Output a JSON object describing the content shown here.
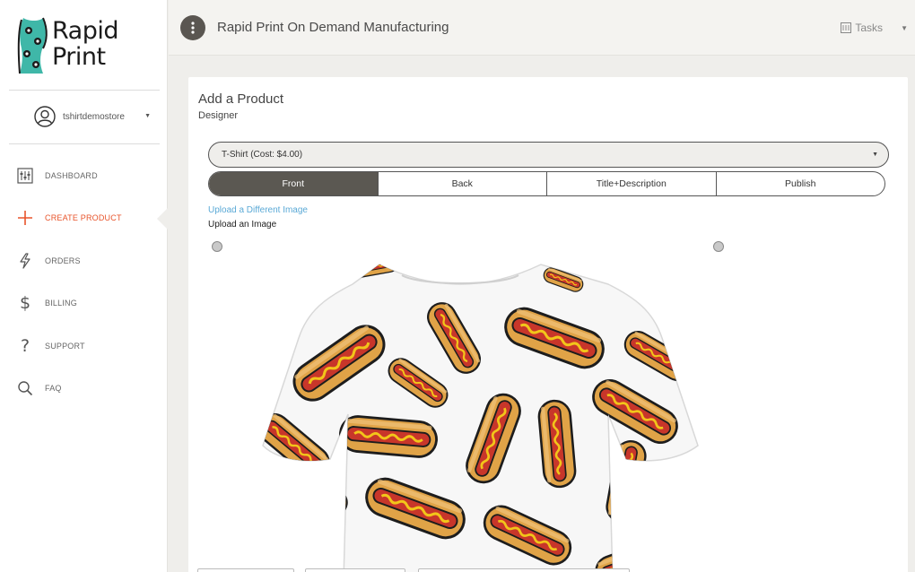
{
  "brand": {
    "line1": "Rapid",
    "line2": "Print"
  },
  "user": {
    "name": "tshirtdemostore"
  },
  "nav": {
    "items": [
      {
        "label": "DASHBOARD",
        "icon": "dashboard-icon"
      },
      {
        "label": "CREATE PRODUCT",
        "icon": "plus-icon"
      },
      {
        "label": "ORDERS",
        "icon": "lightning-icon"
      },
      {
        "label": "BILLING",
        "icon": "dollar-icon"
      },
      {
        "label": "SUPPORT",
        "icon": "question-icon"
      },
      {
        "label": "FAQ",
        "icon": "search-icon"
      }
    ],
    "active_index": 1
  },
  "header": {
    "title": "Rapid Print On Demand Manufacturing",
    "tasks_label": "Tasks"
  },
  "card": {
    "title": "Add a Product",
    "subtitle": "Designer",
    "product_select": {
      "value": "T-Shirt (Cost: $4.00)"
    },
    "tabs": [
      {
        "label": "Front",
        "active": true
      },
      {
        "label": "Back",
        "active": false
      },
      {
        "label": "Title+Description",
        "active": false
      },
      {
        "label": "Publish",
        "active": false
      }
    ],
    "upload_link": "Upload a Different Image",
    "upload_label": "Upload an Image"
  },
  "colors": {
    "accent": "#e8542b",
    "dark": "#5b5852",
    "link": "#5aa9d6",
    "hotdog_bun": "#e0a347",
    "hotdog_sausage": "#c8362a",
    "mustard": "#f2c51a"
  },
  "preview": {
    "image": "hot dog pattern t-shirt"
  }
}
